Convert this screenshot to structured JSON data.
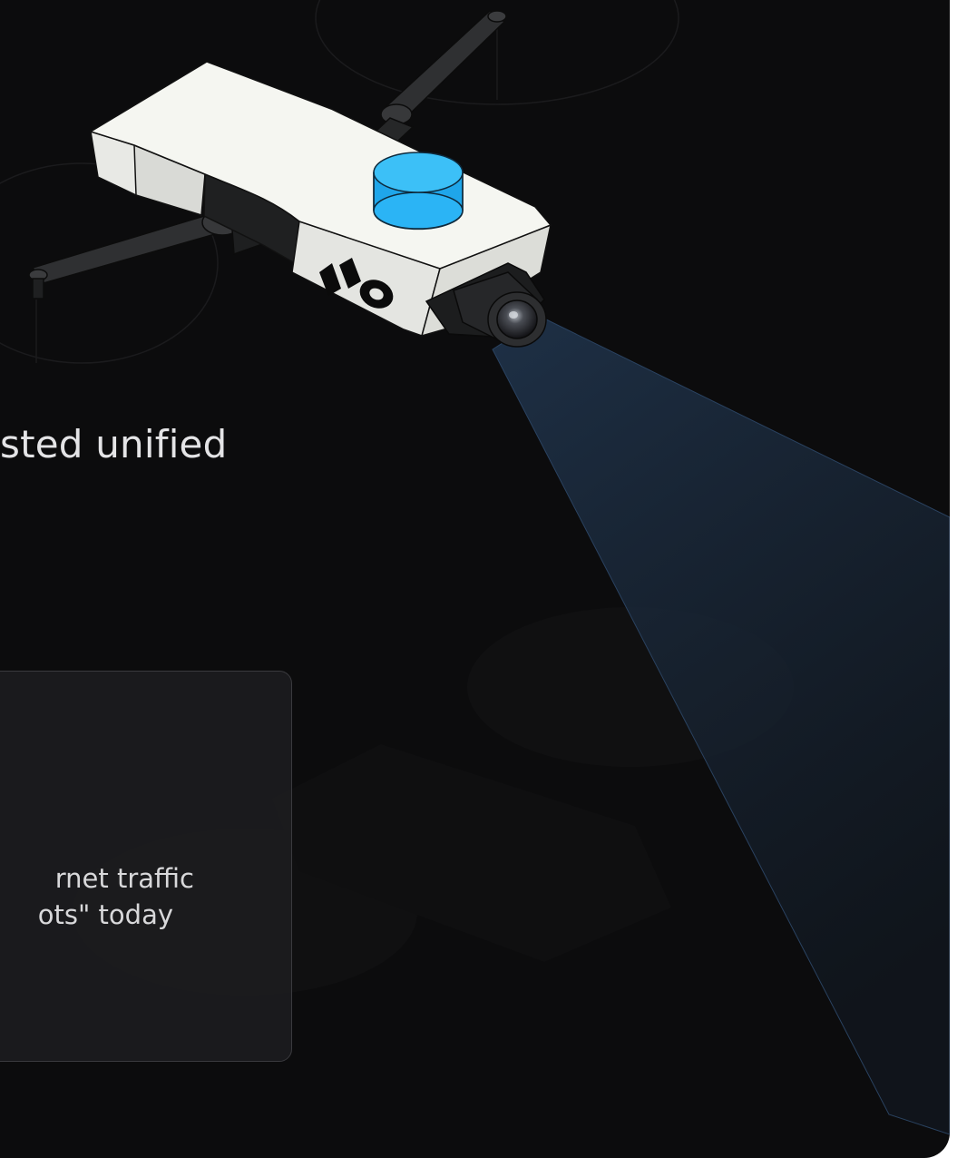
{
  "hero": {
    "headline_fragment": "sted unified"
  },
  "stat_card": {
    "line_1": "rnet traffic",
    "line_2": "ots\" today"
  },
  "illustration": {
    "subject": "drone-with-camera-icon",
    "logo_text": "HO"
  },
  "colors": {
    "background": "#0c0c0d",
    "drone_body": "#f5f6f1",
    "sensor_accent": "#26aef0",
    "camera_beam": "#1b2c40",
    "card_border": "#3a3a3e"
  }
}
